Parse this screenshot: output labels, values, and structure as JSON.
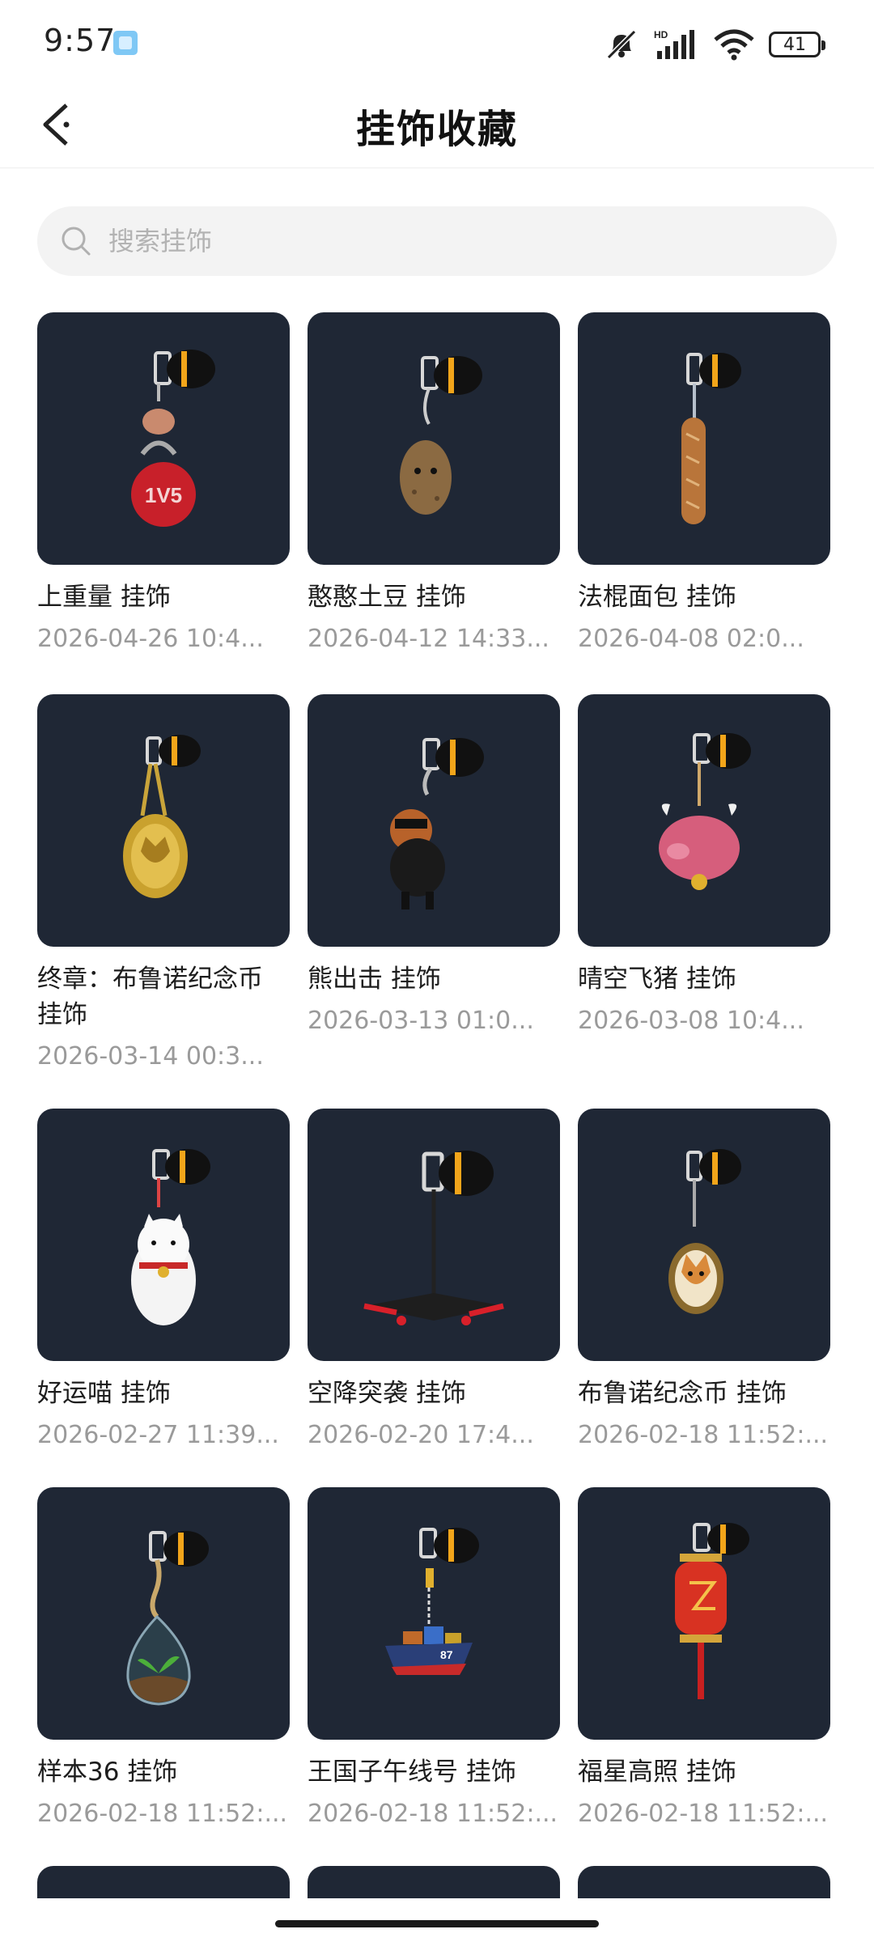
{
  "status_bar": {
    "time": "9:57",
    "signal_label": "HD",
    "battery": "41"
  },
  "header": {
    "title": "挂饰收藏"
  },
  "search": {
    "placeholder": "搜索挂饰"
  },
  "theme": {
    "thumb_bg": "#1f2735",
    "accent": "#f2a51a"
  },
  "items": [
    {
      "name": " 上重量 挂饰",
      "date": "2026-04-26 10:4...",
      "charm": "weight-1v5"
    },
    {
      "name": "憨憨土豆 挂饰",
      "date": "2026-04-12 14:33...",
      "charm": "potato"
    },
    {
      "name": "法棍面包 挂饰",
      "date": "2026-04-08 02:0...",
      "charm": "baguette"
    },
    {
      "name": "终章：布鲁诺纪念币 挂饰",
      "date": "2026-03-14 00:3...",
      "charm": "gold-coin"
    },
    {
      "name": "熊出击 挂饰",
      "date": "2026-03-13 01:0...",
      "charm": "bear"
    },
    {
      "name": "晴空飞猪 挂饰",
      "date": "2026-03-08 10:4...",
      "charm": "flying-pig"
    },
    {
      "name": "好运喵 挂饰",
      "date": "2026-02-27 11:39...",
      "charm": "lucky-cat"
    },
    {
      "name": "空降突袭 挂饰",
      "date": "2026-02-20 17:4...",
      "charm": "airdrop"
    },
    {
      "name": "布鲁诺纪念币 挂饰",
      "date": "2026-02-18 11:52:...",
      "charm": "corgi-coin"
    },
    {
      "name": "样本36 挂饰",
      "date": "2026-02-18 11:52:...",
      "charm": "terrarium"
    },
    {
      "name": "王国子午线号 挂饰",
      "date": "2026-02-18 11:52:...",
      "charm": "ship"
    },
    {
      "name": "福星高照 挂饰",
      "date": "2026-02-18 11:52:...",
      "charm": "lantern"
    }
  ],
  "labels": {
    "ship_hull": "87",
    "weight_text": "1V5"
  }
}
